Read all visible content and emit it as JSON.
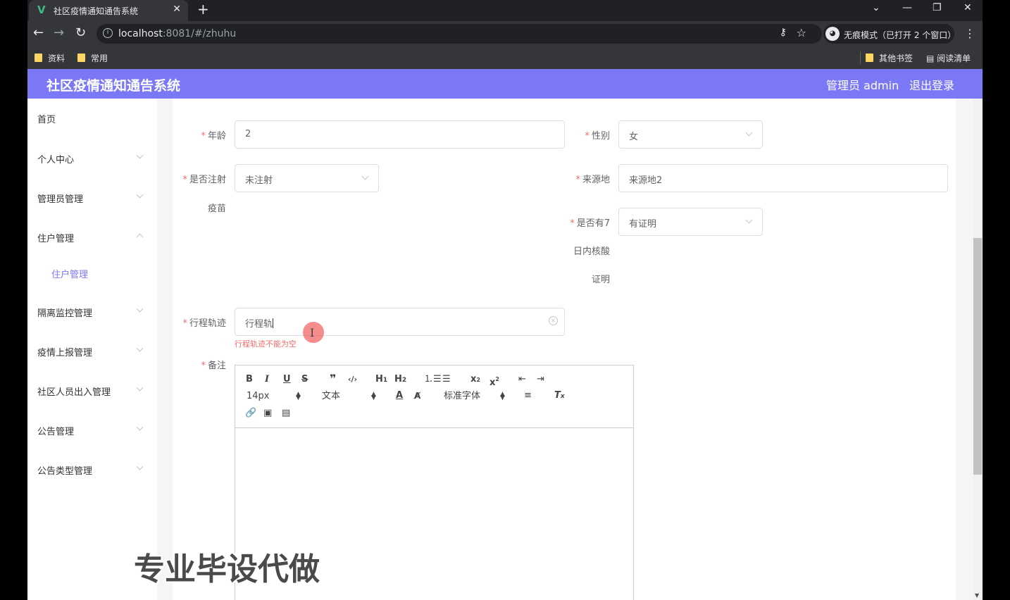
{
  "browser": {
    "tab_title": "社区疫情通知通告系统",
    "tab_favicon": "V",
    "url_host": "localhost",
    "url_rest": ":8081/#/zhuhu",
    "incognito_label": "无痕模式（已打开 2 个窗口）",
    "bookmarks": [
      "资料",
      "常用"
    ],
    "other_bookmarks": "其他书签",
    "reading_list": "阅读清单"
  },
  "app": {
    "title": "社区疫情通知通告系统",
    "user": "管理员 admin",
    "logout": "退出登录",
    "accent_color": "#7a78f5"
  },
  "sidebar": {
    "items": [
      "首页",
      "个人中心",
      "管理员管理",
      "住户管理",
      "隔离监控管理",
      "疫情上报管理",
      "社区人员出入管理",
      "公告管理",
      "公告类型管理"
    ],
    "sub_item": "住户管理"
  },
  "form": {
    "age_label": "年龄",
    "age_value": "2",
    "gender_label": "性别",
    "gender_value": "女",
    "vaccine_label_1": "是否注射",
    "vaccine_label_2": "疫苗",
    "vaccine_value": "未注射",
    "origin_label": "来源地",
    "origin_value": "来源地2",
    "test_label_1": "是否有7",
    "test_label_2": "日内核酸",
    "test_label_3": "证明",
    "test_value": "有证明",
    "track_label": "行程轨迹",
    "track_value": "行程轨",
    "track_error": "行程轨迹不能为空",
    "remark_label": "备注",
    "required_mark": "*"
  },
  "editor": {
    "font_size": "14px",
    "paragraph": "文本",
    "font_family": "标准字体"
  },
  "watermark": "专业毕设代做"
}
